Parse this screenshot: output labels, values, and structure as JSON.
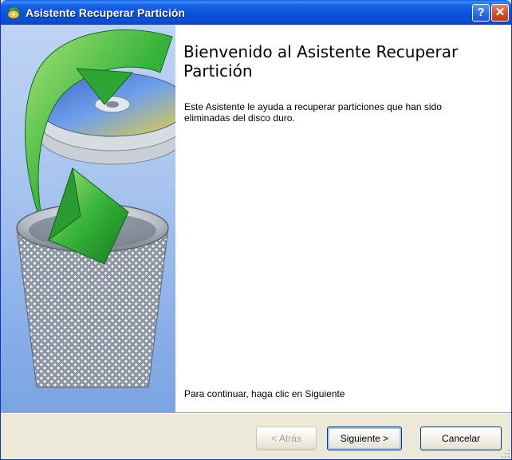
{
  "window": {
    "title": "Asistente Recuperar Partición",
    "help_label": "?",
    "close_label": "✕"
  },
  "content": {
    "heading": "Bienvenido al Asistente Recuperar Partición",
    "description": "Este Asistente le ayuda a recuperar particiones que han sido eliminadas del disco duro.",
    "footer_hint": "Para continuar, haga clic en Siguiente"
  },
  "buttons": {
    "back": "< Atrás",
    "next": "Siguiente >",
    "cancel": "Cancelar"
  },
  "icons": {
    "title": "wizard-app-icon",
    "illustration": "disk-recycle-bin-recover-icon"
  },
  "colors": {
    "titlebar": "#0a52d8",
    "panel": "#a9c5ef",
    "dialog_bg": "#ece9d8"
  }
}
